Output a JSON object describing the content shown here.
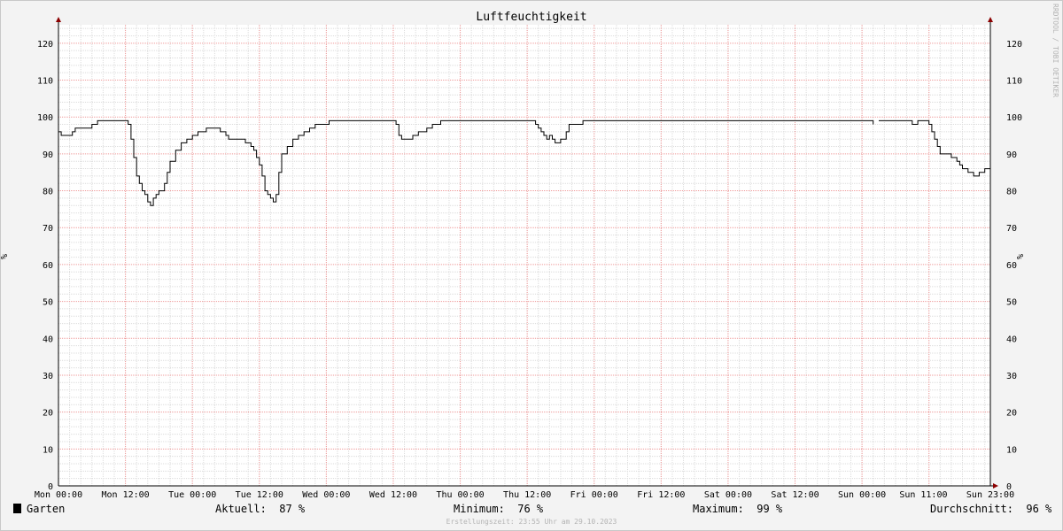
{
  "chart_data": {
    "type": "line",
    "title": "Luftfeuchtigkeit",
    "ylabel": "%",
    "ylabel_right": "%",
    "ylim": [
      0,
      125
    ],
    "yticks": [
      0,
      10,
      20,
      30,
      40,
      50,
      60,
      70,
      80,
      90,
      100,
      110,
      120
    ],
    "xlabels": [
      "Mon 00:00",
      "Mon 12:00",
      "Tue 00:00",
      "Tue 12:00",
      "Wed 00:00",
      "Wed 12:00",
      "Thu 00:00",
      "Thu 12:00",
      "Fri 00:00",
      "Fri 12:00",
      "Sat 00:00",
      "Sat 12:00",
      "Sun 00:00",
      "Sun 11:00",
      "Sun 23:00"
    ],
    "grid": true,
    "color": "#000000",
    "series": [
      {
        "name": "Garten",
        "points": [
          [
            "Mon 00:00",
            96
          ],
          [
            "Mon 00:30",
            95
          ],
          [
            "Mon 01:30",
            95
          ],
          [
            "Mon 02:30",
            96
          ],
          [
            "Mon 03:00",
            97
          ],
          [
            "Mon 05:00",
            97
          ],
          [
            "Mon 06:00",
            98
          ],
          [
            "Mon 07:00",
            99
          ],
          [
            "Mon 12:00",
            99
          ],
          [
            "Mon 12:30",
            98
          ],
          [
            "Mon 13:00",
            94
          ],
          [
            "Mon 13:30",
            89
          ],
          [
            "Mon 14:00",
            84
          ],
          [
            "Mon 14:30",
            82
          ],
          [
            "Mon 15:00",
            80
          ],
          [
            "Mon 15:30",
            79
          ],
          [
            "Mon 16:00",
            77
          ],
          [
            "Mon 16:30",
            76
          ],
          [
            "Mon 17:00",
            78
          ],
          [
            "Mon 17:30",
            79
          ],
          [
            "Mon 18:00",
            80
          ],
          [
            "Mon 19:00",
            82
          ],
          [
            "Mon 19:30",
            85
          ],
          [
            "Mon 20:00",
            88
          ],
          [
            "Mon 21:00",
            91
          ],
          [
            "Mon 22:00",
            93
          ],
          [
            "Mon 23:00",
            94
          ],
          [
            "Tue 00:00",
            95
          ],
          [
            "Tue 01:00",
            96
          ],
          [
            "Tue 02:30",
            97
          ],
          [
            "Tue 04:00",
            97
          ],
          [
            "Tue 05:00",
            96
          ],
          [
            "Tue 06:00",
            95
          ],
          [
            "Tue 06:30",
            94
          ],
          [
            "Tue 08:30",
            94
          ],
          [
            "Tue 09:30",
            93
          ],
          [
            "Tue 10:30",
            92
          ],
          [
            "Tue 11:00",
            91
          ],
          [
            "Tue 11:30",
            89
          ],
          [
            "Tue 12:00",
            87
          ],
          [
            "Tue 12:30",
            84
          ],
          [
            "Tue 13:00",
            80
          ],
          [
            "Tue 13:30",
            79
          ],
          [
            "Tue 14:00",
            78
          ],
          [
            "Tue 14:30",
            77
          ],
          [
            "Tue 15:00",
            79
          ],
          [
            "Tue 15:30",
            85
          ],
          [
            "Tue 16:00",
            90
          ],
          [
            "Tue 17:00",
            92
          ],
          [
            "Tue 18:00",
            94
          ],
          [
            "Tue 19:00",
            95
          ],
          [
            "Tue 20:00",
            96
          ],
          [
            "Tue 21:00",
            97
          ],
          [
            "Tue 22:00",
            98
          ],
          [
            "Wed 00:00",
            98
          ],
          [
            "Wed 00:30",
            99
          ],
          [
            "Wed 12:00",
            99
          ],
          [
            "Wed 12:30",
            98
          ],
          [
            "Wed 13:00",
            95
          ],
          [
            "Wed 13:30",
            94
          ],
          [
            "Wed 15:00",
            94
          ],
          [
            "Wed 15:30",
            95
          ],
          [
            "Wed 16:30",
            96
          ],
          [
            "Wed 18:00",
            97
          ],
          [
            "Wed 19:00",
            98
          ],
          [
            "Wed 20:00",
            98
          ],
          [
            "Wed 20:30",
            99
          ],
          [
            "Thu 13:00",
            99
          ],
          [
            "Thu 13:30",
            98
          ],
          [
            "Thu 14:00",
            97
          ],
          [
            "Thu 14:30",
            96
          ],
          [
            "Thu 15:00",
            95
          ],
          [
            "Thu 15:30",
            94
          ],
          [
            "Thu 16:00",
            95
          ],
          [
            "Thu 16:30",
            94
          ],
          [
            "Thu 17:00",
            93
          ],
          [
            "Thu 18:00",
            94
          ],
          [
            "Thu 19:00",
            96
          ],
          [
            "Thu 19:30",
            98
          ],
          [
            "Thu 21:30",
            98
          ],
          [
            "Thu 22:00",
            99
          ],
          [
            "Sun 01:30",
            99
          ],
          [
            "Sun 02:00",
            98
          ],
          [
            "Sun 02:30",
            null
          ],
          [
            "Sun 03:00",
            99
          ],
          [
            "Sun 08:30",
            99
          ],
          [
            "Sun 09:00",
            98
          ],
          [
            "Sun 09:30",
            98
          ],
          [
            "Sun 10:00",
            99
          ],
          [
            "Sun 11:30",
            99
          ],
          [
            "Sun 12:00",
            98
          ],
          [
            "Sun 12:30",
            96
          ],
          [
            "Sun 13:00",
            94
          ],
          [
            "Sun 13:30",
            92
          ],
          [
            "Sun 14:00",
            90
          ],
          [
            "Sun 15:30",
            90
          ],
          [
            "Sun 16:00",
            89
          ],
          [
            "Sun 17:00",
            88
          ],
          [
            "Sun 17:30",
            87
          ],
          [
            "Sun 18:00",
            86
          ],
          [
            "Sun 19:00",
            85
          ],
          [
            "Sun 20:00",
            84
          ],
          [
            "Sun 21:00",
            85
          ],
          [
            "Sun 22:00",
            86
          ],
          [
            "Sun 23:00",
            87
          ]
        ]
      }
    ]
  },
  "legend": {
    "series_name": "Garten",
    "current": "Aktuell:  87 %",
    "minimum": "Minimum:  76 %",
    "maximum": "Maximum:  99 %",
    "average": "Durchschnitt:  96 %"
  },
  "footer": "Erstellungszeit: 23:55 Uhr am 29.10.2023",
  "watermark": "RRDTOOL / TOBI OETIKER"
}
